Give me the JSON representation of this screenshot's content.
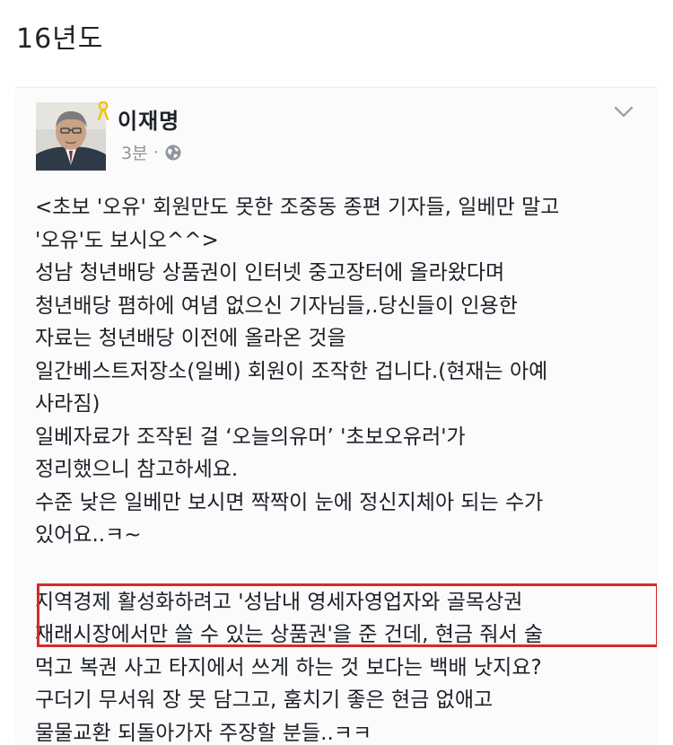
{
  "caption": "16년도",
  "post": {
    "author": "이재명",
    "time": "3분",
    "separator": "·",
    "icons": {
      "ribbon": "yellow-ribbon-icon",
      "globe": "globe-icon",
      "menu": "chevron-down-icon"
    },
    "colors": {
      "highlight_border": "#d62a2a",
      "meta_text": "#90949c",
      "ribbon": "#f2c300"
    },
    "paragraph1": [
      "<초보 '오유' 회원만도 못한 조중동 종편 기자들, 일베만 말고",
      "'오유'도 보시오^^>",
      "성남 청년배당 상품권이 인터넷 중고장터에 올라왔다며",
      "청년배당 폄하에 여념 없으신 기자님들,.당신들이 인용한",
      "자료는 청년배당 이전에 올라온 것을",
      "일간베스트저장소(일베) 회원이 조작한 겁니다.(현재는 아예",
      "사라짐)",
      "일베자료가 조작된 걸 ‘오늘의유머’ '초보오유러'가",
      "정리했으니 참고하세요.",
      "수준 낮은 일베만 보시면 짝짝이 눈에 정신지체아 되는 수가",
      "있어요..ㅋ~"
    ],
    "paragraph2": [
      "지역경제 활성화하려고 '성남내 영세자영업자와 골목상권",
      "재래시장에서만 쓸 수 있는 상품권'을 준 건데, 현금 줘서 술",
      "먹고 복권 사고 타지에서 쓰게 하는 것 보다는 백배 낫지요?",
      "구더기 무서워 장 못 담그고, 훔치기 좋은 현금 없애고",
      "물물교환 되돌아가자 주장할 분들..ㅋㅋ"
    ]
  }
}
